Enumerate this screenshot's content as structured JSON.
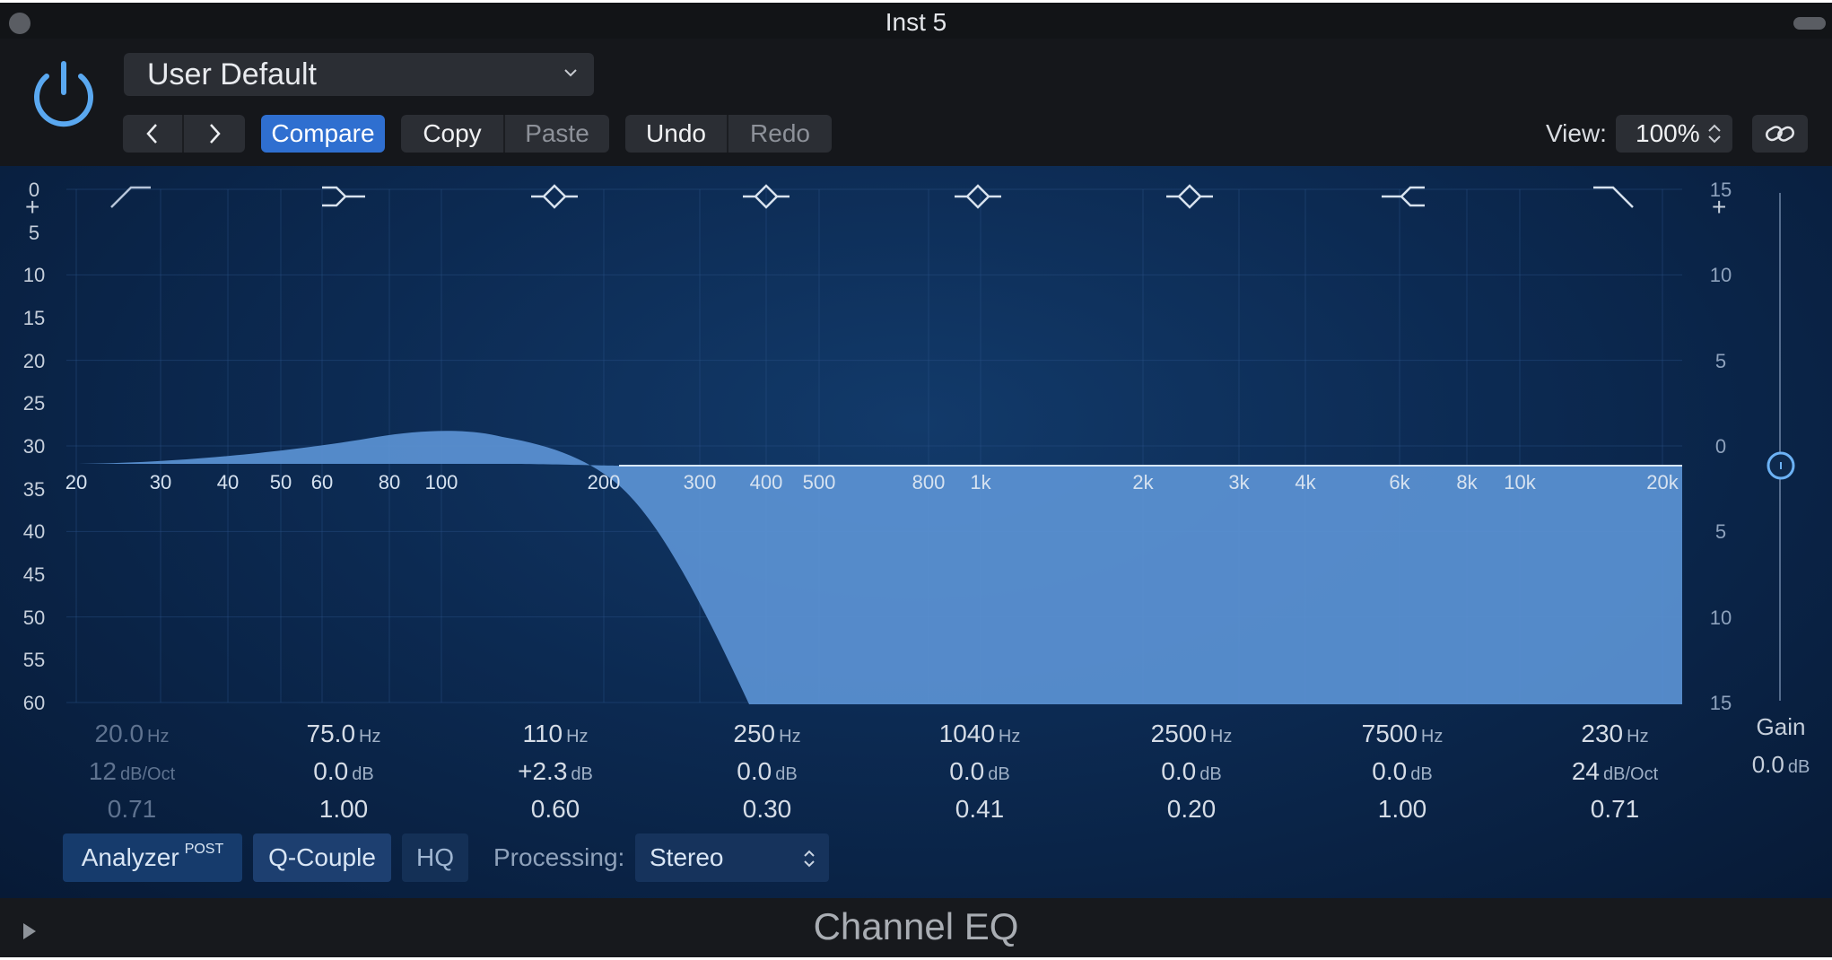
{
  "window": {
    "title": "Inst 5"
  },
  "header": {
    "preset": "User Default",
    "compare_label": "Compare",
    "copy_label": "Copy",
    "paste_label": "Paste",
    "undo_label": "Undo",
    "redo_label": "Redo",
    "view_label": "View:",
    "view_value": "100%"
  },
  "graph": {
    "db_scale_left": [
      "0",
      "5",
      "10",
      "15",
      "20",
      "25",
      "30",
      "35",
      "40",
      "45",
      "50",
      "55",
      "60"
    ],
    "db_scale_right": [
      "15",
      "10",
      "5",
      "0",
      "5",
      "10",
      "15"
    ],
    "freq_ticks": [
      "20",
      "30",
      "40",
      "50",
      "60",
      "80",
      "100",
      "200",
      "300",
      "400",
      "500",
      "800",
      "1k",
      "2k",
      "3k",
      "4k",
      "6k",
      "8k",
      "10k",
      "20k"
    ],
    "plus_label": "+",
    "curve_color": "#5b93d4"
  },
  "bands": [
    {
      "freq": "20.0",
      "freq_unit": "Hz",
      "gain": "12",
      "gain_unit": "dB/Oct",
      "q": "0.71",
      "enabled": false
    },
    {
      "freq": "75.0",
      "freq_unit": "Hz",
      "gain": "0.0",
      "gain_unit": "dB",
      "q": "1.00",
      "enabled": true
    },
    {
      "freq": "110",
      "freq_unit": "Hz",
      "gain": "+2.3",
      "gain_unit": "dB",
      "q": "0.60",
      "enabled": true
    },
    {
      "freq": "250",
      "freq_unit": "Hz",
      "gain": "0.0",
      "gain_unit": "dB",
      "q": "0.30",
      "enabled": true
    },
    {
      "freq": "1040",
      "freq_unit": "Hz",
      "gain": "0.0",
      "gain_unit": "dB",
      "q": "0.41",
      "enabled": true
    },
    {
      "freq": "2500",
      "freq_unit": "Hz",
      "gain": "0.0",
      "gain_unit": "dB",
      "q": "0.20",
      "enabled": true
    },
    {
      "freq": "7500",
      "freq_unit": "Hz",
      "gain": "0.0",
      "gain_unit": "dB",
      "q": "1.00",
      "enabled": true
    },
    {
      "freq": "230",
      "freq_unit": "Hz",
      "gain": "24",
      "gain_unit": "dB/Oct",
      "q": "0.71",
      "enabled": true
    }
  ],
  "gain": {
    "label": "Gain",
    "value": "0.0",
    "unit": "dB"
  },
  "controls": {
    "analyzer_label": "Analyzer",
    "analyzer_sup": "POST",
    "qcouple_label": "Q-Couple",
    "hq_label": "HQ",
    "processing_label": "Processing:",
    "processing_value": "Stereo"
  },
  "footer": {
    "title": "Channel EQ"
  }
}
